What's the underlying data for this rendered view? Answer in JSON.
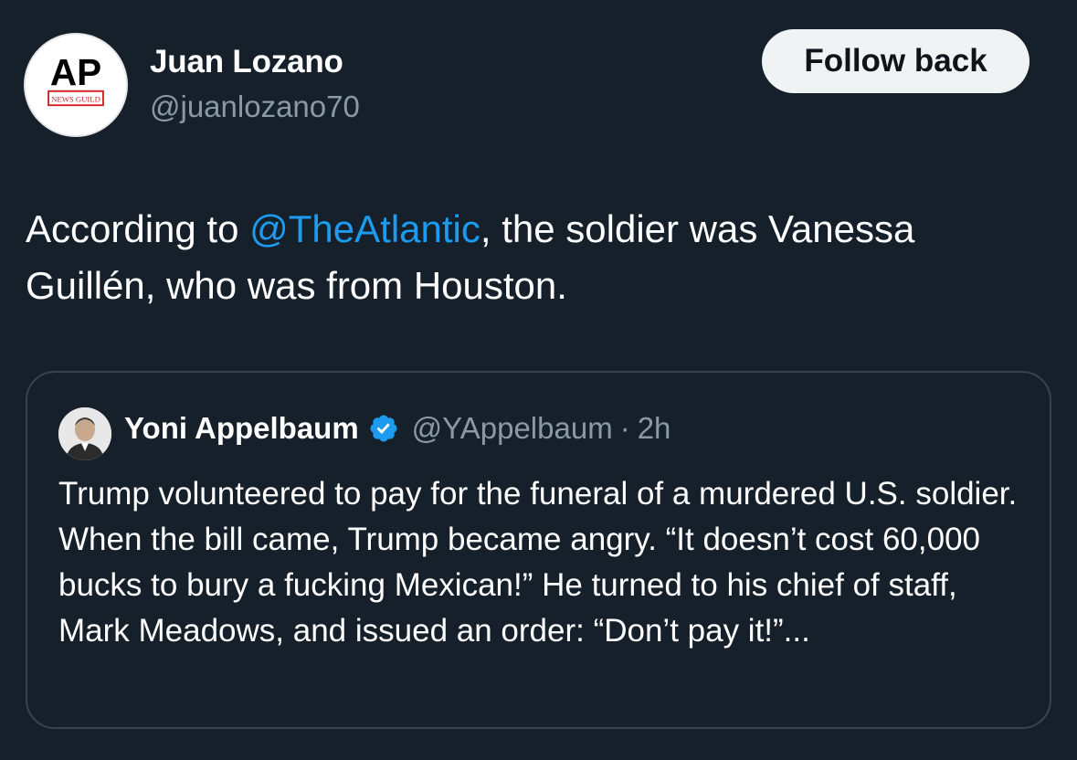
{
  "author": {
    "avatar_logo_text": "AP",
    "avatar_logo_subtext": "NEWS GUILD",
    "name": "Juan Lozano",
    "handle": "@juanlozano70"
  },
  "follow_button": {
    "label": "Follow back"
  },
  "tweet": {
    "text_before": "According to ",
    "mention": "@TheAtlantic",
    "text_after": ", the soldier was Vanessa Guillén, who was from Houston."
  },
  "quoted_tweet": {
    "name": "Yoni Appelbaum",
    "verified": true,
    "handle": "@YAppelbaum",
    "separator": "·",
    "time": "2h",
    "text": "Trump volunteered to pay for the funeral of a murdered U.S. soldier. When the bill came, Trump became angry. “It doesn’t cost 60,000 bucks to bury a fucking Mexican!” He turned to his chief of staff, Mark Meadows, and issued an order: “Don’t pay it!”..."
  },
  "colors": {
    "background": "#15202b",
    "accent": "#1d9bf0",
    "secondary_text": "#8b98a5",
    "border": "#38444d",
    "button_bg": "#eff3f4",
    "ap_red": "#d22027"
  },
  "icons": {
    "avatar": "ap-news-guild-logo",
    "verified": "verified-badge-icon"
  }
}
